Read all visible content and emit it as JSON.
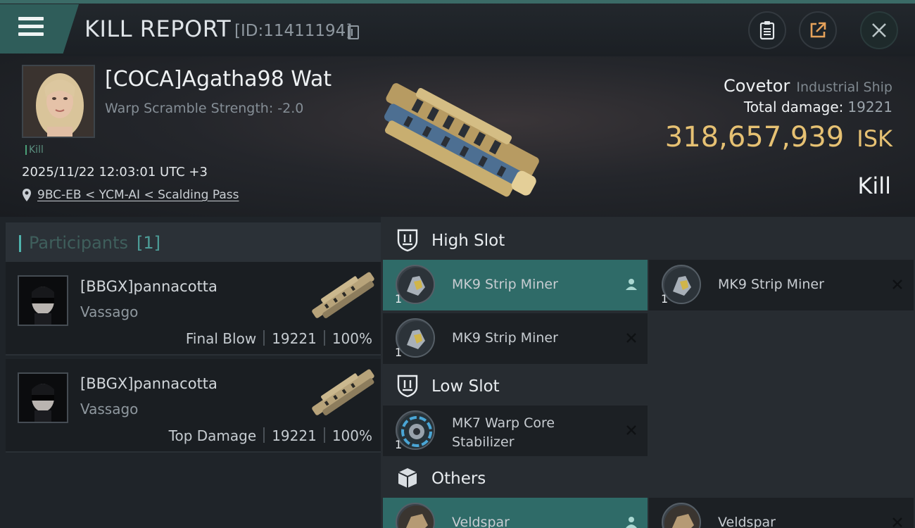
{
  "header": {
    "title": "KILL REPORT",
    "report_id": "[ID:11411194]",
    "menu_icon": "hamburger-menu-icon",
    "actions": [
      "clipboard-icon",
      "share-icon",
      "close-icon"
    ]
  },
  "victim": {
    "name": "[COCA]Agatha98 Wat",
    "warp_scramble": "Warp Scramble Strength: -2.0",
    "tag": "Kill",
    "datetime": "2025/11/22 12:03:01 UTC +3",
    "location": "9BC-EB < YCM-AI < Scalding Pass",
    "ship_name": "Covetor",
    "ship_type": "Industrial Ship",
    "total_damage_label": "Total damage:",
    "total_damage": "19221",
    "isk_value": "318,657,939",
    "isk_unit": "ISK",
    "result": "Kill"
  },
  "participants": {
    "title": "Participants",
    "count": "[1]",
    "items": [
      {
        "name": "[BBGX]pannacotta",
        "ship": "Vassago",
        "role": "Final Blow",
        "damage": "19221",
        "percent": "100%"
      },
      {
        "name": "[BBGX]pannacotta",
        "ship": "Vassago",
        "role": "Top Damage",
        "damage": "19221",
        "percent": "100%"
      }
    ]
  },
  "fittings": {
    "high_slot": {
      "title": "High Slot",
      "modules": [
        {
          "name": "MK9 Strip Miner",
          "qty": "1",
          "state": "person-icon"
        },
        {
          "name": "MK9 Strip Miner",
          "qty": "1",
          "state": "x-icon"
        },
        {
          "name": "MK9 Strip Miner",
          "qty": "1",
          "state": "x-icon"
        }
      ]
    },
    "low_slot": {
      "title": "Low Slot",
      "modules": [
        {
          "name": "MK7 Warp Core Stabilizer",
          "qty": "1",
          "state": "x-icon"
        }
      ]
    },
    "others": {
      "title": "Others",
      "modules": [
        {
          "name": "Veldspar",
          "qty": "",
          "state": "person-icon"
        },
        {
          "name": "Veldspar",
          "qty": "",
          "state": "x-icon"
        }
      ]
    }
  },
  "colors": {
    "accent_teal": "#2f6b68",
    "isk_gold": "#e6c173",
    "background": "#14181d"
  }
}
